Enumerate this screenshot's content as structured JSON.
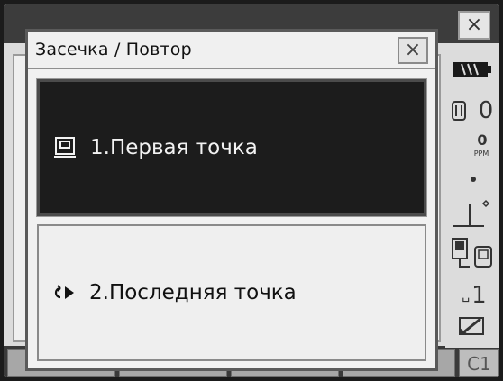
{
  "dialog": {
    "title": "Засечка / Повтор",
    "close_label": "×",
    "options": [
      {
        "label": "1.Первая точка",
        "icon": "point-card-icon",
        "selected": true
      },
      {
        "label": "2.Последняя точка",
        "icon": "arrow-right-icon",
        "selected": false
      }
    ]
  },
  "background_window": {
    "close_label": "×",
    "softkey_c1": "C1"
  },
  "status_bar": {
    "battery_icon": "battery-icon",
    "prism_constant": "0",
    "ppm_value": "0",
    "ppm_unit": "PPM",
    "signal_icon": "dot-icon",
    "tilt_icon": "tilt-compensation-icon",
    "comm_icon": "communication-icon",
    "input_mode": "1",
    "edit_icon": "pencil-icon"
  }
}
